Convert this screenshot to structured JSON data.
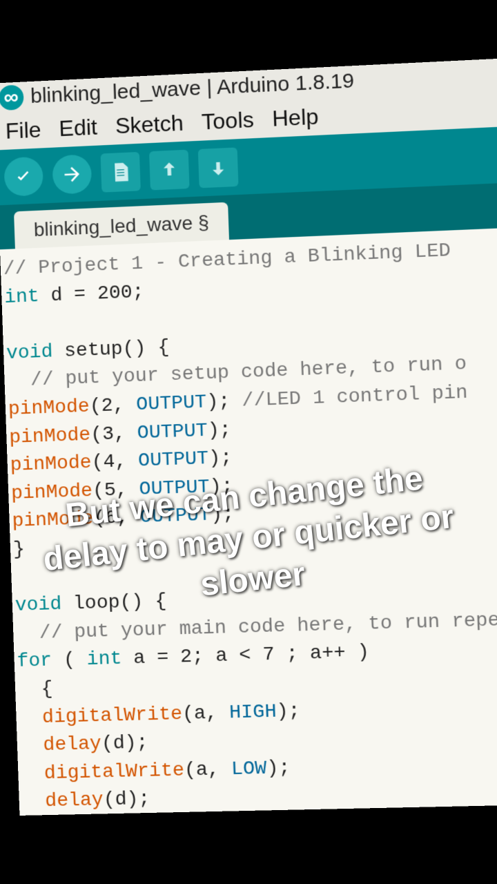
{
  "window": {
    "title": "blinking_led_wave | Arduino 1.8.19"
  },
  "menu": {
    "file": "File",
    "edit": "Edit",
    "sketch": "Sketch",
    "tools": "Tools",
    "help": "Help"
  },
  "tab": {
    "label": "blinking_led_wave §"
  },
  "code": {
    "l1_comment": "// Project 1 - Creating a Blinking LED",
    "l2_a": "int",
    "l2_b": " d = 200;",
    "l4_a": "void",
    "l4_b": " setup",
    "l4_c": "() {",
    "l5_comment": "  // put your setup code here, to run o",
    "l6_a": "pinMode",
    "l6_b": "(2, ",
    "l6_c": "OUTPUT",
    "l6_d": "); ",
    "l6_e": "//LED 1 control pin",
    "l7_a": "pinMode",
    "l7_b": "(3, ",
    "l7_c": "OUTPUT",
    "l7_d": ");",
    "l8_a": "pinMode",
    "l8_b": "(4, ",
    "l8_c": "OUTPUT",
    "l8_d": ");",
    "l9_a": "pinMode",
    "l9_b": "(5, ",
    "l9_c": "OUTPUT",
    "l9_d": ");",
    "l10_a": "pinMode",
    "l10_b": "(6, ",
    "l10_c": "OUTPUT",
    "l10_d": ");",
    "l11": "}",
    "l13_a": "void",
    "l13_b": " loop",
    "l13_c": "() {",
    "l14_comment": "  // put your main code here, to run repea",
    "l15_a": "for",
    "l15_b": " ( ",
    "l15_c": "int",
    "l15_d": " a = 2; a < 7 ; a++ )",
    "l16": "  {",
    "l17_a": "  digitalWrite",
    "l17_b": "(a, ",
    "l17_c": "HIGH",
    "l17_d": ");",
    "l18_a": "  delay",
    "l18_b": "(d);",
    "l19_a": "  digitalWrite",
    "l19_b": "(a, ",
    "l19_c": "LOW",
    "l19_d": ");",
    "l20_a": "  delay",
    "l20_b": "(d);"
  },
  "caption": {
    "text": "But we can change the delay to may or quicker or slower"
  }
}
